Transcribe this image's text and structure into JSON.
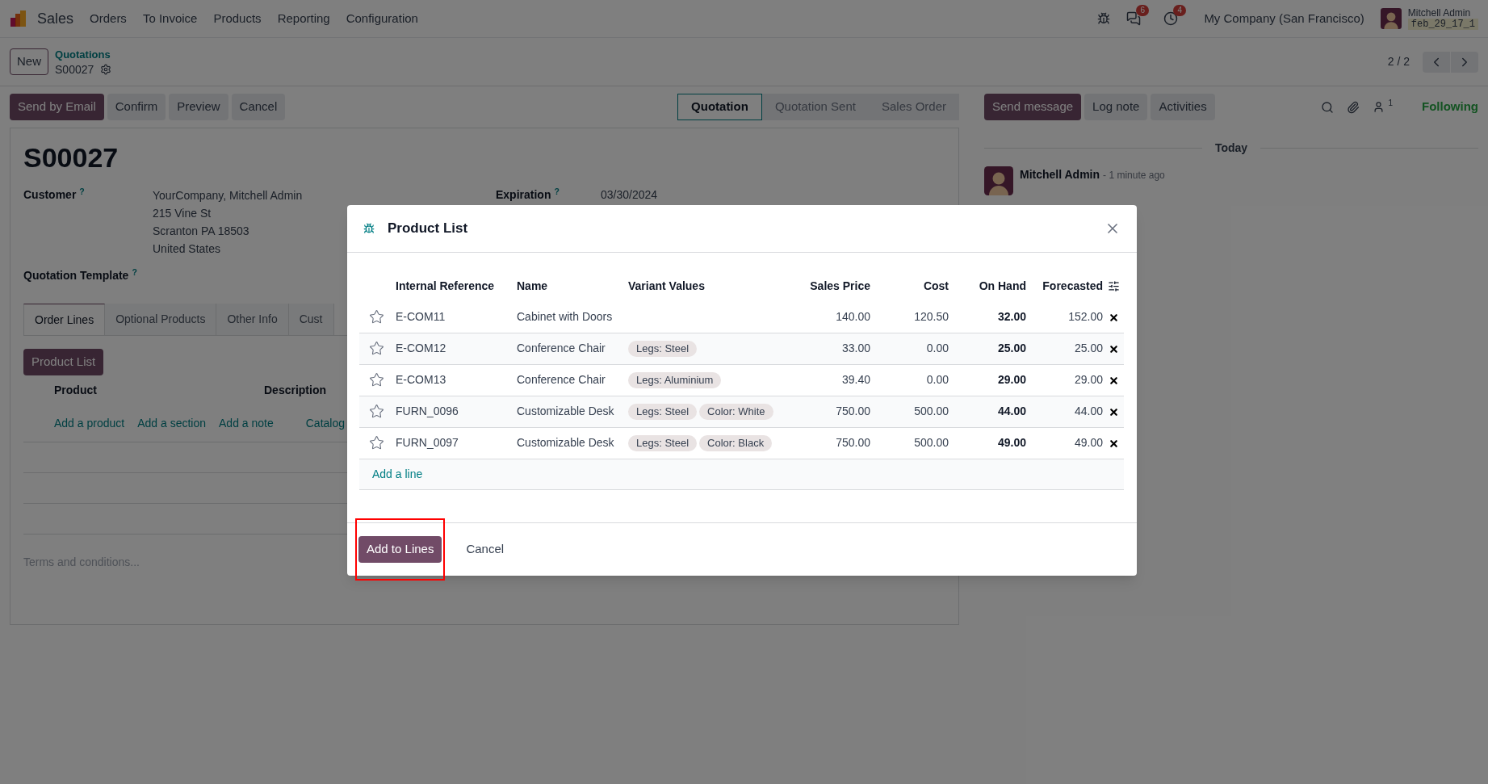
{
  "navbar": {
    "app_name": "Sales",
    "menu": [
      "Orders",
      "To Invoice",
      "Products",
      "Reporting",
      "Configuration"
    ],
    "messages_badge": "6",
    "activities_badge": "4",
    "company": "My Company (San Francisco)",
    "user_name": "Mitchell Admin",
    "database": "feb_29_17_1"
  },
  "control_panel": {
    "new_button": "New",
    "breadcrumb": "Quotations",
    "record": "S00027",
    "pager": "2 / 2"
  },
  "actions": [
    {
      "label": "Send by Email",
      "kind": "primary"
    },
    {
      "label": "Confirm",
      "kind": "secondary"
    },
    {
      "label": "Preview",
      "kind": "secondary"
    },
    {
      "label": "Cancel",
      "kind": "secondary"
    }
  ],
  "statusbar": [
    {
      "label": "Quotation",
      "selected": true
    },
    {
      "label": "Quotation Sent",
      "selected": false
    },
    {
      "label": "Sales Order",
      "selected": false
    }
  ],
  "form": {
    "title": "S00027",
    "customer": {
      "label": "Customer",
      "help": "?",
      "lines": [
        "YourCompany, Mitchell Admin",
        "215 Vine St",
        "Scranton PA 18503",
        "United States"
      ]
    },
    "expiration": {
      "label": "Expiration",
      "help": "?",
      "value": "03/30/2024"
    },
    "template": {
      "label": "Quotation Template",
      "help": "?"
    },
    "tabs": [
      {
        "label": "Order Lines",
        "selected": true
      },
      {
        "label": "Optional Products",
        "selected": false
      },
      {
        "label": "Other Info",
        "selected": false
      },
      {
        "label": "Cust",
        "selected": false
      }
    ],
    "product_list_button": "Product List",
    "columns": [
      "Product",
      "Description"
    ],
    "add_links": [
      "Add a product",
      "Add a section",
      "Add a note",
      "Catalog"
    ],
    "terms_placeholder": "Terms and conditions..."
  },
  "chatter": {
    "buttons": [
      {
        "label": "Send message",
        "kind": "primary"
      },
      {
        "label": "Log note",
        "kind": "secondary"
      },
      {
        "label": "Activities",
        "kind": "secondary"
      }
    ],
    "followers_count": "1",
    "following": "Following",
    "date_separator": "Today",
    "message": {
      "author": "Mitchell Admin",
      "time": "- 1 minute ago"
    }
  },
  "dialog": {
    "title": "Product List",
    "columns": [
      "Internal Reference",
      "Name",
      "Variant Values",
      "Sales Price",
      "Cost",
      "On Hand",
      "Forecasted"
    ],
    "rows": [
      {
        "favorite": false,
        "ref": "E-COM11",
        "name": "Cabinet with Doors",
        "variants": [],
        "price": "140.00",
        "cost": "120.50",
        "on_hand": "32.00",
        "forecasted": "152.00"
      },
      {
        "favorite": false,
        "ref": "E-COM12",
        "name": "Conference Chair",
        "variants": [
          "Legs: Steel"
        ],
        "price": "33.00",
        "cost": "0.00",
        "on_hand": "25.00",
        "forecasted": "25.00"
      },
      {
        "favorite": false,
        "ref": "E-COM13",
        "name": "Conference Chair",
        "variants": [
          "Legs: Aluminium"
        ],
        "price": "39.40",
        "cost": "0.00",
        "on_hand": "29.00",
        "forecasted": "29.00"
      },
      {
        "favorite": false,
        "ref": "FURN_0096",
        "name": "Customizable Desk",
        "variants": [
          "Legs: Steel",
          "Color: White"
        ],
        "price": "750.00",
        "cost": "500.00",
        "on_hand": "44.00",
        "forecasted": "44.00"
      },
      {
        "favorite": false,
        "ref": "FURN_0097",
        "name": "Customizable Desk",
        "variants": [
          "Legs: Steel",
          "Color: Black"
        ],
        "price": "750.00",
        "cost": "500.00",
        "on_hand": "49.00",
        "forecasted": "49.00"
      }
    ],
    "add_line": "Add a line",
    "buttons": [
      {
        "label": "Add to Lines",
        "kind": "primary",
        "highlighted": true
      },
      {
        "label": "Cancel",
        "kind": "link",
        "highlighted": false
      }
    ]
  }
}
